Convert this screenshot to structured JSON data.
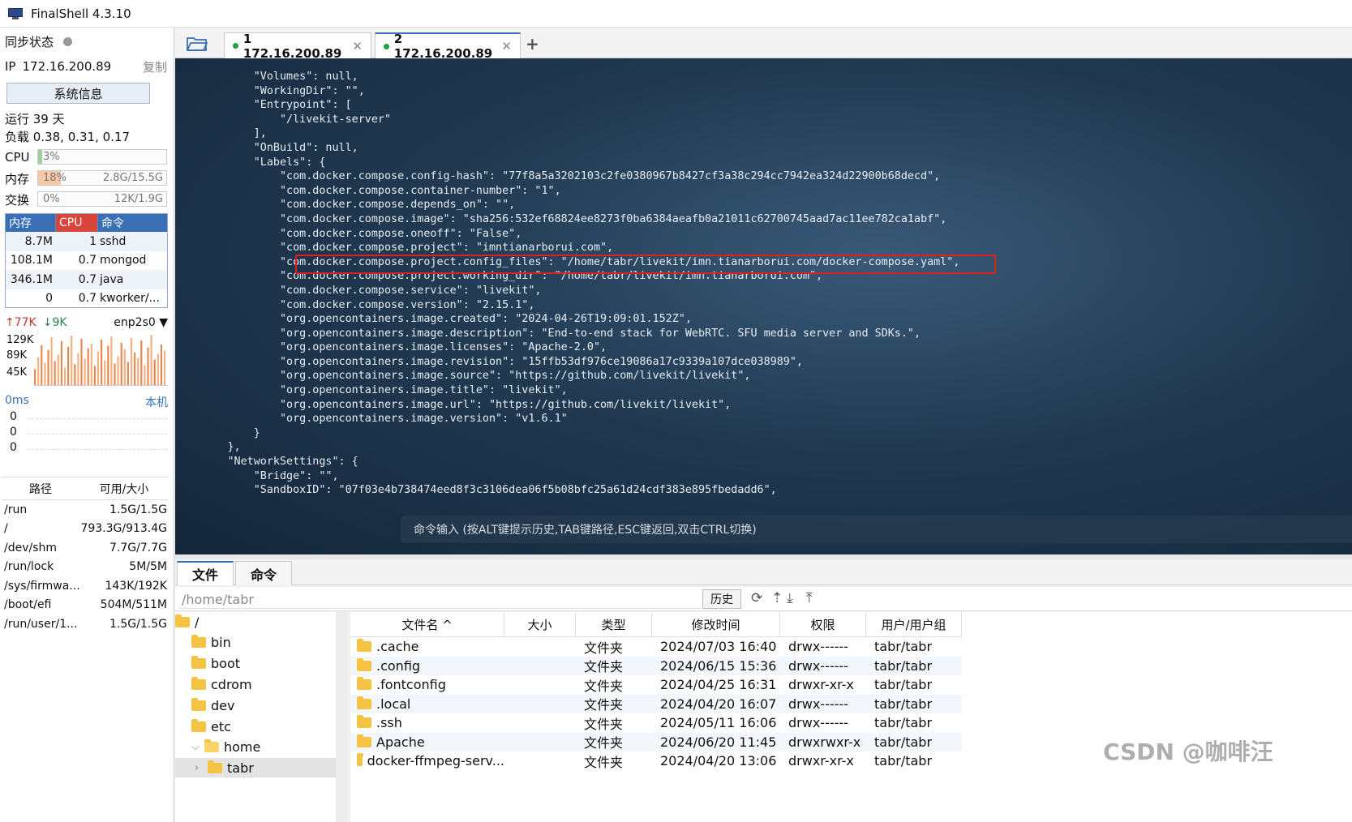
{
  "window": {
    "title": "FinalShell 4.3.10"
  },
  "sidebar": {
    "sync_label": "同步状态",
    "ip_label": "IP",
    "ip": "172.16.200.89",
    "copy": "复制",
    "sysinfo_button": "系统信息",
    "uptime": "运行 39 天",
    "load": "负载 0.38, 0.31, 0.17",
    "cpu": {
      "label": "CPU",
      "percent": "3%",
      "fraction": 0.03
    },
    "mem": {
      "label": "内存",
      "percent": "18%",
      "usage": "2.8G/15.5G",
      "fraction": 0.18
    },
    "swap": {
      "label": "交换",
      "percent": "0%",
      "usage": "12K/1.9G",
      "fraction": 0.0
    },
    "proc_headers": [
      "内存",
      "CPU",
      "命令"
    ],
    "processes": [
      {
        "mem": "8.7M",
        "cpu": "1",
        "cmd": "sshd"
      },
      {
        "mem": "108.1M",
        "cpu": "0.7",
        "cmd": "mongod"
      },
      {
        "mem": "346.1M",
        "cpu": "0.7",
        "cmd": "java"
      },
      {
        "mem": "0",
        "cpu": "0.7",
        "cmd": "kworker/..."
      }
    ],
    "net": {
      "up": "77K",
      "down": "9K",
      "iface": "enp2s0",
      "y_labels": [
        "129K",
        "89K",
        "45K"
      ]
    },
    "ping": {
      "label": "0ms",
      "local": "本机",
      "values": [
        "0",
        "0",
        "0"
      ]
    },
    "disk_headers": [
      "路径",
      "可用/大小"
    ],
    "disks": [
      {
        "path": "/run",
        "size": "1.5G/1.5G"
      },
      {
        "path": "/",
        "size": "793.3G/913.4G"
      },
      {
        "path": "/dev/shm",
        "size": "7.7G/7.7G"
      },
      {
        "path": "/run/lock",
        "size": "5M/5M"
      },
      {
        "path": "/sys/firmwa...",
        "size": "143K/192K"
      },
      {
        "path": "/boot/efi",
        "size": "504M/511M"
      },
      {
        "path": "/run/user/1...",
        "size": "1.5G/1.5G"
      }
    ]
  },
  "tabs": [
    {
      "label": "1  172.16.200.89"
    },
    {
      "label": "2  172.16.200.89"
    }
  ],
  "terminal": {
    "lines": [
      "            \"Volumes\": null,",
      "            \"WorkingDir\": \"\",",
      "            \"Entrypoint\": [",
      "                \"/livekit-server\"",
      "            ],",
      "            \"OnBuild\": null,",
      "            \"Labels\": {",
      "                \"com.docker.compose.config-hash\": \"77f8a5a3202103c2fe0380967b8427cf3a38c294cc7942ea324d22900b68decd\",",
      "                \"com.docker.compose.container-number\": \"1\",",
      "                \"com.docker.compose.depends_on\": \"\",",
      "                \"com.docker.compose.image\": \"sha256:532ef68824ee8273f0ba6384aeafb0a21011c62700745aad7ac11ee782ca1abf\",",
      "                \"com.docker.compose.oneoff\": \"False\",",
      "                \"com.docker.compose.project\": \"imntianarborui.com\",",
      "                \"com.docker.compose.project.config_files\": \"/home/tabr/livekit/imn.tianarborui.com/docker-compose.yaml\",",
      "                \"com.docker.compose.project.working_dir\": \"/home/tabr/livekit/imn.tianarborui.com\",",
      "                \"com.docker.compose.service\": \"livekit\",",
      "                \"com.docker.compose.version\": \"2.15.1\",",
      "                \"org.opencontainers.image.created\": \"2024-04-26T19:09:01.152Z\",",
      "                \"org.opencontainers.image.description\": \"End-to-end stack for WebRTC. SFU media server and SDKs.\",",
      "                \"org.opencontainers.image.licenses\": \"Apache-2.0\",",
      "                \"org.opencontainers.image.revision\": \"15ffb53df976ce19086a17c9339a107dce038989\",",
      "                \"org.opencontainers.image.source\": \"https://github.com/livekit/livekit\",",
      "                \"org.opencontainers.image.title\": \"livekit\",",
      "                \"org.opencontainers.image.url\": \"https://github.com/livekit/livekit\",",
      "                \"org.opencontainers.image.version\": \"v1.6.1\"",
      "            }",
      "        },",
      "        \"NetworkSettings\": {",
      "            \"Bridge\": \"\",",
      "            \"SandboxID\": \"07f03e4b738474eed8f3c3106dea06f5b08bfc25a61d24cdf383e895fbedadd6\","
    ],
    "command_placeholder": "命令输入 (按ALT键提示历史,TAB键路径,ESC键返回,双击CTRL切换)"
  },
  "file_panel": {
    "tabs": [
      "文件",
      "命令"
    ],
    "path": "/home/tabr",
    "history_button": "历史",
    "tree": [
      {
        "name": "/",
        "depth": 0,
        "arrow": ""
      },
      {
        "name": "bin",
        "depth": 1,
        "arrow": ""
      },
      {
        "name": "boot",
        "depth": 1,
        "arrow": ""
      },
      {
        "name": "cdrom",
        "depth": 1,
        "arrow": ""
      },
      {
        "name": "dev",
        "depth": 1,
        "arrow": ""
      },
      {
        "name": "etc",
        "depth": 1,
        "arrow": ""
      },
      {
        "name": "home",
        "depth": 1,
        "arrow": "⌵"
      },
      {
        "name": "tabr",
        "depth": 2,
        "arrow": "›"
      }
    ],
    "columns": [
      "文件名 ^",
      "大小",
      "类型",
      "修改时间",
      "权限",
      "用户/用户组"
    ],
    "files": [
      {
        "name": ".cache",
        "size": "",
        "type": "文件夹",
        "mtime": "2024/07/03 16:40",
        "perm": "drwx------",
        "owner": "tabr/tabr"
      },
      {
        "name": ".config",
        "size": "",
        "type": "文件夹",
        "mtime": "2024/06/15 15:36",
        "perm": "drwx------",
        "owner": "tabr/tabr"
      },
      {
        "name": ".fontconfig",
        "size": "",
        "type": "文件夹",
        "mtime": "2024/04/25 16:31",
        "perm": "drwxr-xr-x",
        "owner": "tabr/tabr"
      },
      {
        "name": ".local",
        "size": "",
        "type": "文件夹",
        "mtime": "2024/04/20 16:07",
        "perm": "drwx------",
        "owner": "tabr/tabr"
      },
      {
        "name": ".ssh",
        "size": "",
        "type": "文件夹",
        "mtime": "2024/05/11 16:06",
        "perm": "drwx------",
        "owner": "tabr/tabr"
      },
      {
        "name": "Apache",
        "size": "",
        "type": "文件夹",
        "mtime": "2024/06/20 11:45",
        "perm": "drwxrwxr-x",
        "owner": "tabr/tabr"
      },
      {
        "name": "docker-ffmpeg-serv...",
        "size": "",
        "type": "文件夹",
        "mtime": "2024/04/20 13:06",
        "perm": "drwxr-xr-x",
        "owner": "tabr/tabr"
      }
    ]
  },
  "watermark": "CSDN @咖啡汪",
  "colors": {
    "accent": "#3a6fb5",
    "cpu_header": "#d9453a",
    "highlight_box": "#e02020",
    "folder": "#f5c343"
  }
}
